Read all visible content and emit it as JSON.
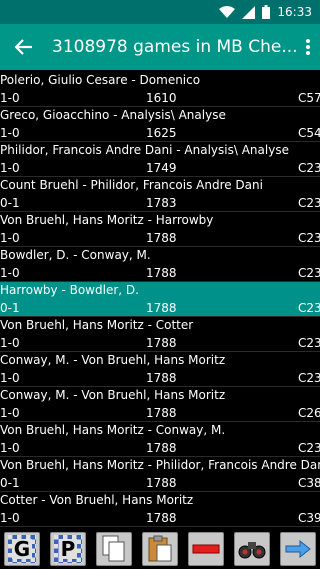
{
  "status": {
    "time": "16:33"
  },
  "appbar": {
    "title": "3108978 games in MB Che..."
  },
  "games": [
    {
      "players": "Polerio, Giulio Cesare - Domenico",
      "result": "1-0",
      "elo": "1610",
      "eco": "C57"
    },
    {
      "players": "Greco, Gioacchino - Analysis\\ Analyse",
      "result": "1-0",
      "elo": "1625",
      "eco": "C54"
    },
    {
      "players": "Philidor, Francois Andre Dani - Analysis\\ Analyse",
      "result": "1-0",
      "elo": "1749",
      "eco": "C23"
    },
    {
      "players": "Count Bruehl - Philidor, Francois Andre Dani",
      "result": "0-1",
      "elo": "1783",
      "eco": "C23"
    },
    {
      "players": "Von Bruehl, Hans Moritz - Harrowby",
      "result": "1-0",
      "elo": "1788",
      "eco": "C23"
    },
    {
      "players": "Bowdler, D. - Conway, M.",
      "result": "1-0",
      "elo": "1788",
      "eco": "C23"
    },
    {
      "players": "Harrowby - Bowdler, D.",
      "result": "0-1",
      "elo": "1788",
      "eco": "C23",
      "selected": true
    },
    {
      "players": "Von Bruehl, Hans Moritz - Cotter",
      "result": "1-0",
      "elo": "1788",
      "eco": "C23"
    },
    {
      "players": "Conway, M. - Von Bruehl, Hans Moritz",
      "result": "1-0",
      "elo": "1788",
      "eco": "C23"
    },
    {
      "players": "Conway, M. - Von Bruehl, Hans Moritz",
      "result": "1-0",
      "elo": "1788",
      "eco": "C26"
    },
    {
      "players": "Von Bruehl, Hans Moritz - Conway, M.",
      "result": "1-0",
      "elo": "1788",
      "eco": "C23"
    },
    {
      "players": "Von Bruehl, Hans Moritz - Philidor, Francois Andre Dani",
      "result": "0-1",
      "elo": "1788",
      "eco": "C38"
    },
    {
      "players": "Cotter - Von Bruehl, Hans Moritz",
      "result": "1-0",
      "elo": "1788",
      "eco": "C39"
    }
  ],
  "toolbar": {
    "g_label": "G",
    "p_label": "P"
  },
  "colors": {
    "statusbar": "#00706c",
    "appbar": "#009688",
    "selected_row": "#00918a"
  }
}
